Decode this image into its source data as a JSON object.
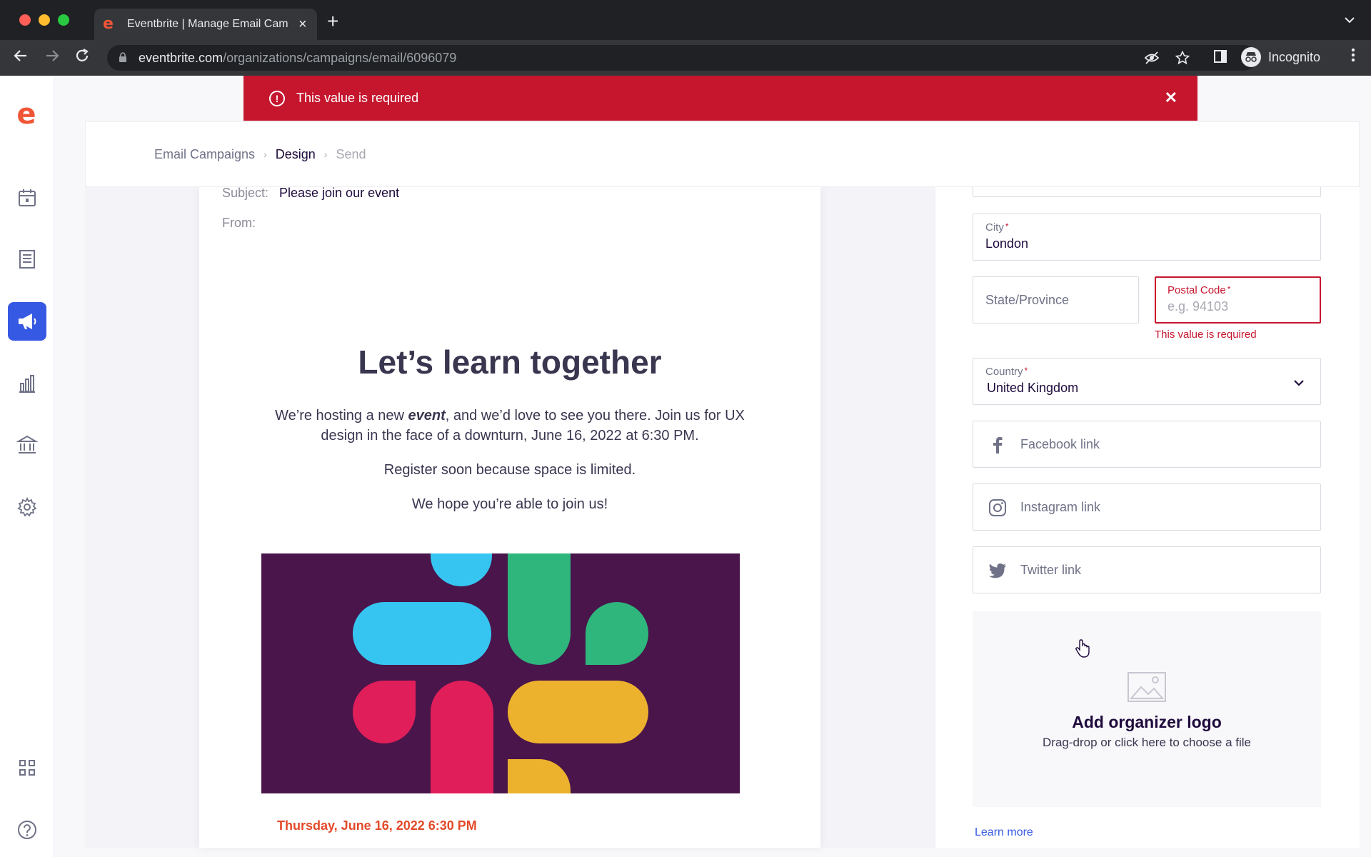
{
  "browser": {
    "tab_title": "Eventbrite | Manage Email Cam",
    "url_host": "eventbrite.com",
    "url_path": "/organizations/campaigns/email/6096079",
    "profile_label": "Incognito"
  },
  "toast": {
    "message": "This value is required",
    "color": "#c5162e"
  },
  "breadcrumb": {
    "items": [
      "Email Campaigns",
      "Design",
      "Send"
    ],
    "current_index": 1
  },
  "email": {
    "subject_label": "Subject:",
    "subject_value": "Please join our event",
    "from_label": "From:",
    "title": "Let’s learn together",
    "para1_before": "We’re hosting a new ",
    "para1_emph": "event",
    "para1_after": ", and we’d love to see you there. Join us for UX design in the face of a downturn, June 16, 2022 at 6:30 PM.",
    "para2": "Register soon because space is limited.",
    "para3": "We hope you’re able to join us!",
    "event_date": "Thursday, June 16, 2022 6:30 PM"
  },
  "form": {
    "city": {
      "label": "City",
      "value": "London"
    },
    "state": {
      "label": "State/Province"
    },
    "postal": {
      "label": "Postal Code",
      "placeholder": "e.g. 94103",
      "error": "This value is required"
    },
    "country": {
      "label": "Country",
      "value": "United Kingdom"
    },
    "facebook": {
      "label": "Facebook link"
    },
    "instagram": {
      "label": "Instagram link"
    },
    "twitter": {
      "label": "Twitter link"
    },
    "logo_upload": {
      "title": "Add organizer logo",
      "subtitle": "Drag-drop or click here to choose a file"
    },
    "learn_more": "Learn more"
  },
  "colors": {
    "brand": "#f05537",
    "accent": "#3659e3",
    "error": "#c5162e",
    "banner_bg": "#4a154b"
  },
  "sidebar_icons": [
    "calendar-icon",
    "orders-icon",
    "megaphone-icon",
    "reports-icon",
    "finance-icon",
    "settings-icon",
    "apps-icon",
    "help-icon"
  ]
}
